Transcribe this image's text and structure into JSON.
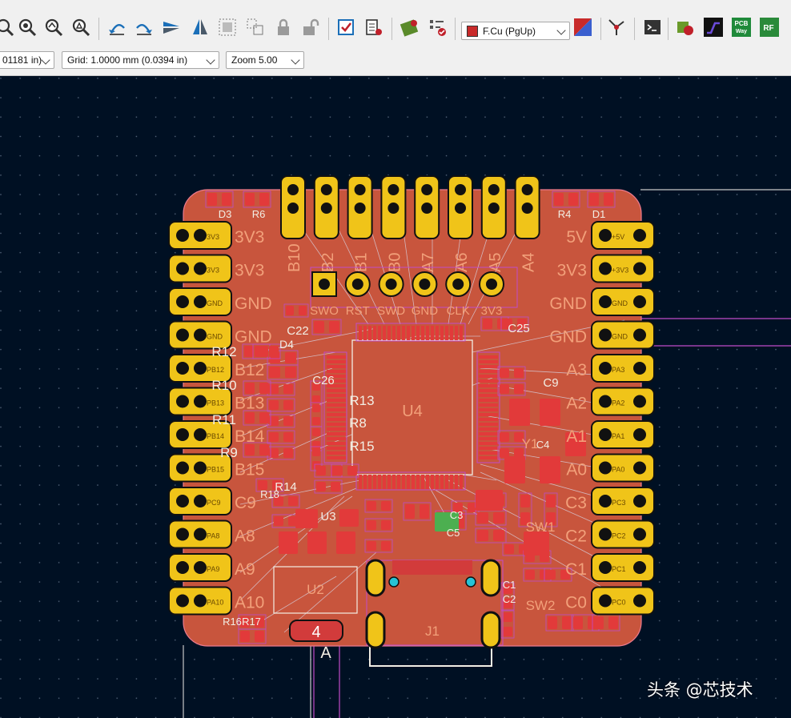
{
  "colors": {
    "board": "#c8553d",
    "pad": "#f0c419",
    "canvas": "#001023",
    "silk": "#f2eee4",
    "courtyard": "#c04bc9"
  },
  "toolbar": {
    "icons": [
      "zoom-fit-icon",
      "zoom-in-icon",
      "zoom-out-icon",
      "zoom-selection-icon",
      "rotate-ccw-icon",
      "rotate-cw-icon",
      "mirror-horizontal-icon",
      "mirror-vertical-icon",
      "group-icon",
      "ungroup-icon",
      "lock-icon",
      "unlock-icon",
      "drc-icon",
      "netlist-icon",
      "footprint-editor-icon",
      "checklist-icon",
      "layer-pair-icon",
      "ratsnest-icon",
      "scripting-console-icon",
      "footprint-assoc-icon",
      "interactive-router-icon",
      "pcbway-icon",
      "rf-tools-icon"
    ],
    "layer_select": "F.Cu (PgUp)",
    "pcbway": "PCB\nWay",
    "rf": "RF"
  },
  "toolbar2": {
    "track_width": "01181 in)",
    "grid": "Grid: 1.0000 mm (0.0394 in)",
    "zoom": "Zoom 5.00"
  },
  "pcb": {
    "left_pins": [
      "3V3",
      "3V3",
      "GND",
      "GND",
      "B12",
      "B13",
      "B14",
      "B15",
      "C9",
      "A8",
      "A9",
      "A10"
    ],
    "left_pad_labels": [
      "3V3",
      "3V3",
      "GND",
      "GND",
      "PB12",
      "PB13",
      "PB14",
      "PB15",
      "PC9",
      "PA8",
      "PA9",
      "PA10"
    ],
    "right_pins": [
      "5V",
      "3V3",
      "GND",
      "GND",
      "A3",
      "A2",
      "A1",
      "A0",
      "C3",
      "C2",
      "C1",
      "C0"
    ],
    "right_pad_labels": [
      "+5V",
      "+3V3",
      "GND",
      "GND",
      "PA3",
      "PA2",
      "PA1",
      "PA0",
      "PC3",
      "PC2",
      "PC1",
      "PC0"
    ],
    "top_pins": [
      "B10",
      "B2",
      "B1",
      "B0",
      "A7",
      "A6",
      "A5",
      "A4"
    ],
    "swd_labels": [
      "SWO",
      "RST",
      "SWD",
      "GND",
      "CLK",
      "3V3"
    ],
    "ref_labels": [
      "D3",
      "R6",
      "R4",
      "D1",
      "C22",
      "C25",
      "D4",
      "C26",
      "R12",
      "R10",
      "R13",
      "R8",
      "R15",
      "R11",
      "R9",
      "U4",
      "C9",
      "Y1",
      "SW1",
      "SW2",
      "U2",
      "J1",
      "C1",
      "C2",
      "C3",
      "C4",
      "C5",
      "R14",
      "R16",
      "R17",
      "R18",
      "U3"
    ],
    "connector_label": "4",
    "connector_letter": "A"
  },
  "watermark": "头条 @芯技术"
}
